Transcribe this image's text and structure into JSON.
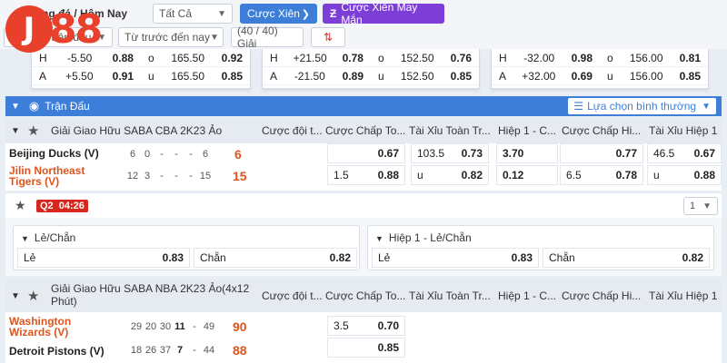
{
  "top": {
    "day_filter": "Bóng đá / Hôm Nay",
    "all_filter": "Tất Cả",
    "parlay_btn": "Cược Xiên",
    "lucky_parlay_btn": "Cược Xiên May Mắn",
    "market_filter": "Bóng rổ trận đấu",
    "time_filter": "Từ trước đến nay",
    "league_count": "(40 / 40) Giải",
    "logo_text": "88"
  },
  "cards": [
    {
      "rows": [
        [
          "H",
          "-5.50",
          "0.88",
          "o",
          "165.50",
          "0.92"
        ],
        [
          "A",
          "+5.50",
          "0.91",
          "u",
          "165.50",
          "0.85"
        ]
      ]
    },
    {
      "rows": [
        [
          "H",
          "+21.50",
          "0.78",
          "o",
          "152.50",
          "0.76"
        ],
        [
          "A",
          "-21.50",
          "0.89",
          "u",
          "152.50",
          "0.85"
        ]
      ]
    },
    {
      "rows": [
        [
          "H",
          "-32.00",
          "0.98",
          "o",
          "156.00",
          "0.81"
        ],
        [
          "A",
          "+32.00",
          "0.69",
          "u",
          "156.00",
          "0.85"
        ]
      ]
    }
  ],
  "section": {
    "title": "Trận Đấu",
    "sort_label": "Lựa chọn bình thường"
  },
  "columns": [
    "Cược đội t...",
    "Cược Chấp To...",
    "Tài Xỉu Toàn Tr...",
    "Hiệp 1 - C...",
    "Cược Chấp Hi...",
    "Tài Xỉu Hiệp 1"
  ],
  "league1": {
    "name": "Giải Giao Hữu SABA CBA 2K23 Ảo",
    "home": {
      "name": "Beijing Ducks (V)",
      "q": [
        "6",
        "0",
        "-",
        "-",
        "-",
        "6"
      ],
      "total": "6"
    },
    "away": {
      "name": "Jilin Northeast Tigers (V)",
      "name_l1": "Jilin Northeast",
      "name_l2": "Tigers (V)",
      "q": [
        "12",
        "3",
        "-",
        "-",
        "-",
        "15"
      ],
      "total": "15"
    },
    "odds_home": {
      "hcap": "0.67",
      "ou_line": "103.5",
      "ou": "0.73",
      "h1": "3.70",
      "h1_hcap": "0.77",
      "h1_ou_line": "46.5",
      "h1_ou": "0.67"
    },
    "odds_away": {
      "hcap_line": "1.5",
      "hcap": "0.88",
      "ou_label": "u",
      "ou": "0.82",
      "h1": "0.12",
      "h1_hcap_line": "6.5",
      "h1_hcap": "0.78",
      "h1_ou_label": "u",
      "h1_ou": "0.88"
    },
    "period": "Q2",
    "clock": "04:26",
    "more": "1",
    "panel_left": {
      "title": "Lẻ/Chẵn",
      "odd_label": "Lẻ",
      "odd": "0.83",
      "even_label": "Chẵn",
      "even": "0.82"
    },
    "panel_right": {
      "title": "Hiệp 1 - Lẻ/Chẵn",
      "odd_label": "Lẻ",
      "odd": "0.83",
      "even_label": "Chẵn",
      "even": "0.82"
    }
  },
  "league2": {
    "name_l1": "Giải Giao Hữu SABA NBA 2K23 Ảo(4x12",
    "name_l2": "Phút)",
    "home": {
      "name_l1": "Washington",
      "name_l2": "Wizards (V)",
      "q": [
        "29",
        "20",
        "30",
        "11",
        "-",
        "49"
      ],
      "total": "90"
    },
    "away": {
      "name": "Detroit Pistons (V)",
      "q": [
        "18",
        "26",
        "37",
        "7",
        "-",
        "44"
      ],
      "total": "88"
    },
    "odds_home": {
      "hcap_line": "3.5",
      "hcap": "0.70"
    },
    "odds_away": {
      "hcap": "0.85"
    }
  }
}
